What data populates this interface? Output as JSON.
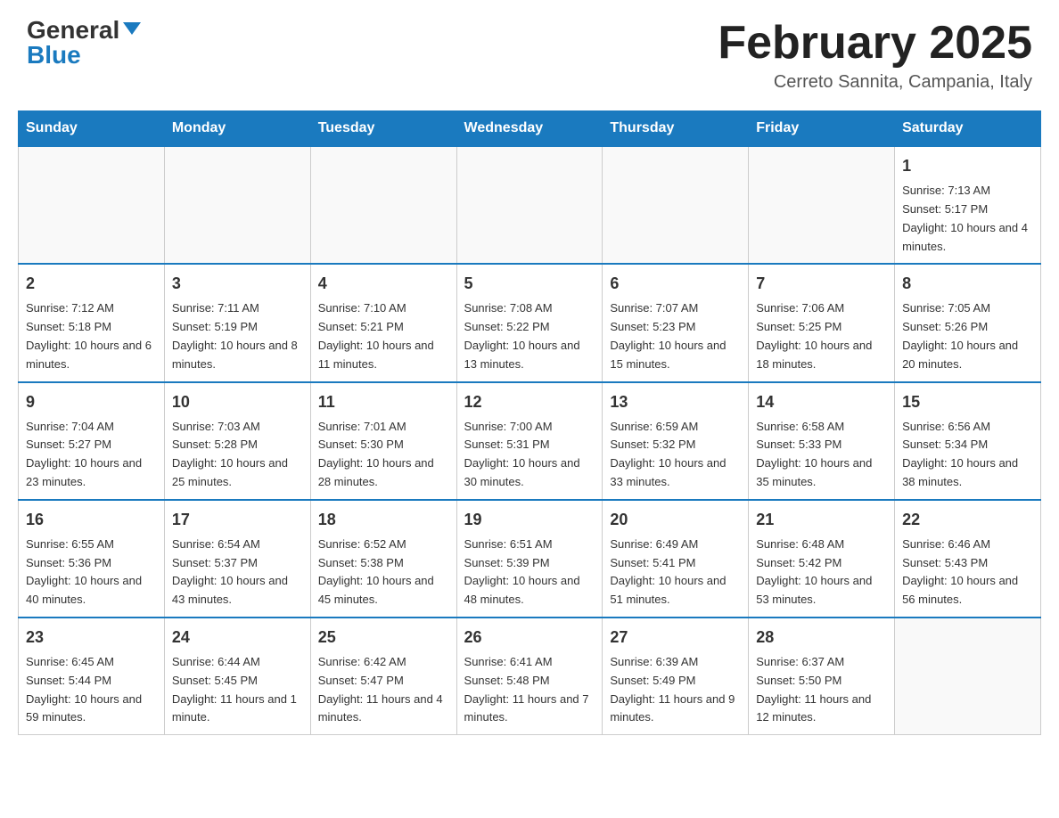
{
  "header": {
    "logo_general": "General",
    "logo_blue": "Blue",
    "month_title": "February 2025",
    "subtitle": "Cerreto Sannita, Campania, Italy"
  },
  "days_of_week": [
    "Sunday",
    "Monday",
    "Tuesday",
    "Wednesday",
    "Thursday",
    "Friday",
    "Saturday"
  ],
  "weeks": [
    [
      {
        "day": "",
        "info": ""
      },
      {
        "day": "",
        "info": ""
      },
      {
        "day": "",
        "info": ""
      },
      {
        "day": "",
        "info": ""
      },
      {
        "day": "",
        "info": ""
      },
      {
        "day": "",
        "info": ""
      },
      {
        "day": "1",
        "info": "Sunrise: 7:13 AM\nSunset: 5:17 PM\nDaylight: 10 hours and 4 minutes."
      }
    ],
    [
      {
        "day": "2",
        "info": "Sunrise: 7:12 AM\nSunset: 5:18 PM\nDaylight: 10 hours and 6 minutes."
      },
      {
        "day": "3",
        "info": "Sunrise: 7:11 AM\nSunset: 5:19 PM\nDaylight: 10 hours and 8 minutes."
      },
      {
        "day": "4",
        "info": "Sunrise: 7:10 AM\nSunset: 5:21 PM\nDaylight: 10 hours and 11 minutes."
      },
      {
        "day": "5",
        "info": "Sunrise: 7:08 AM\nSunset: 5:22 PM\nDaylight: 10 hours and 13 minutes."
      },
      {
        "day": "6",
        "info": "Sunrise: 7:07 AM\nSunset: 5:23 PM\nDaylight: 10 hours and 15 minutes."
      },
      {
        "day": "7",
        "info": "Sunrise: 7:06 AM\nSunset: 5:25 PM\nDaylight: 10 hours and 18 minutes."
      },
      {
        "day": "8",
        "info": "Sunrise: 7:05 AM\nSunset: 5:26 PM\nDaylight: 10 hours and 20 minutes."
      }
    ],
    [
      {
        "day": "9",
        "info": "Sunrise: 7:04 AM\nSunset: 5:27 PM\nDaylight: 10 hours and 23 minutes."
      },
      {
        "day": "10",
        "info": "Sunrise: 7:03 AM\nSunset: 5:28 PM\nDaylight: 10 hours and 25 minutes."
      },
      {
        "day": "11",
        "info": "Sunrise: 7:01 AM\nSunset: 5:30 PM\nDaylight: 10 hours and 28 minutes."
      },
      {
        "day": "12",
        "info": "Sunrise: 7:00 AM\nSunset: 5:31 PM\nDaylight: 10 hours and 30 minutes."
      },
      {
        "day": "13",
        "info": "Sunrise: 6:59 AM\nSunset: 5:32 PM\nDaylight: 10 hours and 33 minutes."
      },
      {
        "day": "14",
        "info": "Sunrise: 6:58 AM\nSunset: 5:33 PM\nDaylight: 10 hours and 35 minutes."
      },
      {
        "day": "15",
        "info": "Sunrise: 6:56 AM\nSunset: 5:34 PM\nDaylight: 10 hours and 38 minutes."
      }
    ],
    [
      {
        "day": "16",
        "info": "Sunrise: 6:55 AM\nSunset: 5:36 PM\nDaylight: 10 hours and 40 minutes."
      },
      {
        "day": "17",
        "info": "Sunrise: 6:54 AM\nSunset: 5:37 PM\nDaylight: 10 hours and 43 minutes."
      },
      {
        "day": "18",
        "info": "Sunrise: 6:52 AM\nSunset: 5:38 PM\nDaylight: 10 hours and 45 minutes."
      },
      {
        "day": "19",
        "info": "Sunrise: 6:51 AM\nSunset: 5:39 PM\nDaylight: 10 hours and 48 minutes."
      },
      {
        "day": "20",
        "info": "Sunrise: 6:49 AM\nSunset: 5:41 PM\nDaylight: 10 hours and 51 minutes."
      },
      {
        "day": "21",
        "info": "Sunrise: 6:48 AM\nSunset: 5:42 PM\nDaylight: 10 hours and 53 minutes."
      },
      {
        "day": "22",
        "info": "Sunrise: 6:46 AM\nSunset: 5:43 PM\nDaylight: 10 hours and 56 minutes."
      }
    ],
    [
      {
        "day": "23",
        "info": "Sunrise: 6:45 AM\nSunset: 5:44 PM\nDaylight: 10 hours and 59 minutes."
      },
      {
        "day": "24",
        "info": "Sunrise: 6:44 AM\nSunset: 5:45 PM\nDaylight: 11 hours and 1 minute."
      },
      {
        "day": "25",
        "info": "Sunrise: 6:42 AM\nSunset: 5:47 PM\nDaylight: 11 hours and 4 minutes."
      },
      {
        "day": "26",
        "info": "Sunrise: 6:41 AM\nSunset: 5:48 PM\nDaylight: 11 hours and 7 minutes."
      },
      {
        "day": "27",
        "info": "Sunrise: 6:39 AM\nSunset: 5:49 PM\nDaylight: 11 hours and 9 minutes."
      },
      {
        "day": "28",
        "info": "Sunrise: 6:37 AM\nSunset: 5:50 PM\nDaylight: 11 hours and 12 minutes."
      },
      {
        "day": "",
        "info": ""
      }
    ]
  ]
}
